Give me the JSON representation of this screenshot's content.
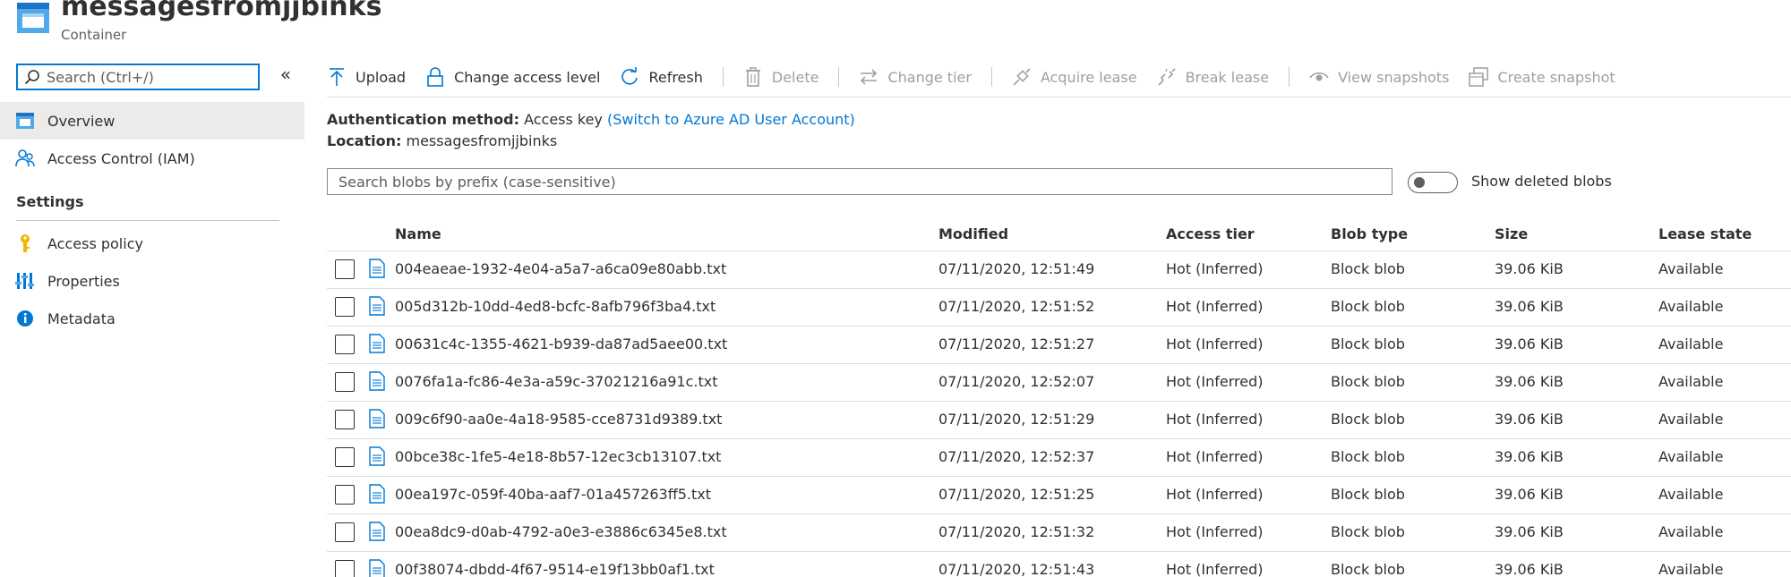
{
  "header": {
    "title": "messagesfromjjbinks",
    "subtitle": "Container"
  },
  "leftnav": {
    "search_placeholder": "Search (Ctrl+/)",
    "collapse_label": "«",
    "items": [
      {
        "label": "Overview",
        "icon": "container-overview-icon",
        "active": true
      },
      {
        "label": "Access Control (IAM)",
        "icon": "people-icon"
      }
    ],
    "settings_title": "Settings",
    "settings_items": [
      {
        "label": "Access policy",
        "icon": "key-icon"
      },
      {
        "label": "Properties",
        "icon": "properties-bars-icon"
      },
      {
        "label": "Metadata",
        "icon": "info-icon"
      }
    ]
  },
  "toolbar": {
    "upload": "Upload",
    "change_access_level": "Change access level",
    "refresh": "Refresh",
    "delete": "Delete",
    "change_tier": "Change tier",
    "acquire_lease": "Acquire lease",
    "break_lease": "Break lease",
    "view_snapshots": "View snapshots",
    "create_snapshot": "Create snapshot"
  },
  "info": {
    "auth_label": "Authentication method:",
    "auth_value": "Access key",
    "auth_link": "(Switch to Azure AD User Account)",
    "location_label": "Location:",
    "location_value": "messagesfromjjbinks"
  },
  "blob_search": {
    "placeholder": "Search blobs by prefix (case-sensitive)"
  },
  "toggle": {
    "label": "Show deleted blobs"
  },
  "table": {
    "columns": [
      "Name",
      "Modified",
      "Access tier",
      "Blob type",
      "Size",
      "Lease state"
    ],
    "rows": [
      [
        "004eaeae-1932-4e04-a5a7-a6ca09e80abb.txt",
        "07/11/2020, 12:51:49",
        "Hot (Inferred)",
        "Block blob",
        "39.06 KiB",
        "Available"
      ],
      [
        "005d312b-10dd-4ed8-bcfc-8afb796f3ba4.txt",
        "07/11/2020, 12:51:52",
        "Hot (Inferred)",
        "Block blob",
        "39.06 KiB",
        "Available"
      ],
      [
        "00631c4c-1355-4621-b939-da87ad5aee00.txt",
        "07/11/2020, 12:51:27",
        "Hot (Inferred)",
        "Block blob",
        "39.06 KiB",
        "Available"
      ],
      [
        "0076fa1a-fc86-4e3a-a59c-37021216a91c.txt",
        "07/11/2020, 12:52:07",
        "Hot (Inferred)",
        "Block blob",
        "39.06 KiB",
        "Available"
      ],
      [
        "009c6f90-aa0e-4a18-9585-cce8731d9389.txt",
        "07/11/2020, 12:51:29",
        "Hot (Inferred)",
        "Block blob",
        "39.06 KiB",
        "Available"
      ],
      [
        "00bce38c-1fe5-4e18-8b57-12ec3cb13107.txt",
        "07/11/2020, 12:52:37",
        "Hot (Inferred)",
        "Block blob",
        "39.06 KiB",
        "Available"
      ],
      [
        "00ea197c-059f-40ba-aaf7-01a457263ff5.txt",
        "07/11/2020, 12:51:25",
        "Hot (Inferred)",
        "Block blob",
        "39.06 KiB",
        "Available"
      ],
      [
        "00ea8dc9-d0ab-4792-a0e3-e3886c6345e8.txt",
        "07/11/2020, 12:51:32",
        "Hot (Inferred)",
        "Block blob",
        "39.06 KiB",
        "Available"
      ],
      [
        "00f38074-dbdd-4f67-9514-e19f13bb0af1.txt",
        "07/11/2020, 12:51:43",
        "Hot (Inferred)",
        "Block blob",
        "39.06 KiB",
        "Available"
      ]
    ]
  },
  "colors": {
    "accent": "#0078d4",
    "active_bg": "#edebe9",
    "disabled_text": "#a19f9d",
    "key_gold": "#f2b600"
  }
}
